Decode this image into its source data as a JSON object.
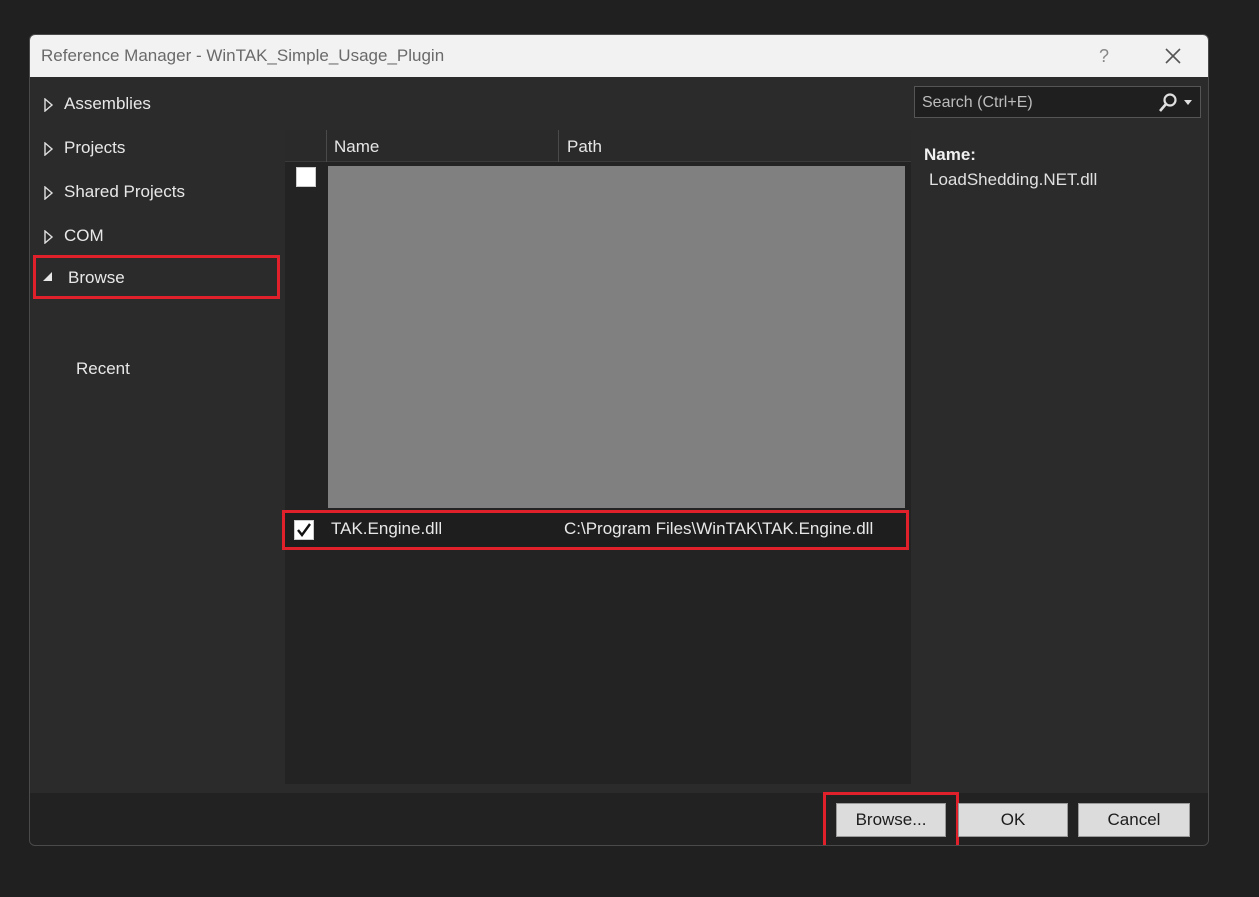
{
  "window": {
    "title": "Reference Manager - WinTAK_Simple_Usage_Plugin",
    "help_label": "?",
    "icons": {
      "close": "close-icon"
    }
  },
  "sidebar": {
    "items": [
      {
        "label": "Assemblies",
        "expanded": false
      },
      {
        "label": "Projects",
        "expanded": false
      },
      {
        "label": "Shared Projects",
        "expanded": false
      },
      {
        "label": "COM",
        "expanded": false
      },
      {
        "label": "Browse",
        "expanded": true,
        "selected": true
      }
    ],
    "subitems": [
      {
        "label": "Recent"
      }
    ]
  },
  "search": {
    "placeholder": "Search (Ctrl+E)",
    "value": ""
  },
  "grid": {
    "columns": [
      "Name",
      "Path"
    ],
    "rows": [
      {
        "checked": false,
        "name": "",
        "path": ""
      },
      {
        "checked": true,
        "name": "TAK.Engine.dll",
        "path": "C:\\Program Files\\WinTAK\\TAK.Engine.dll"
      }
    ]
  },
  "details": {
    "name_label": "Name:",
    "name_value": "LoadShedding.NET.dll"
  },
  "footer": {
    "browse_label": "Browse...",
    "ok_label": "OK",
    "cancel_label": "Cancel"
  },
  "colors": {
    "highlight": "#e0202b",
    "dialog_bg": "#2b2b2b",
    "titlebar_bg": "#f2f2f2"
  }
}
